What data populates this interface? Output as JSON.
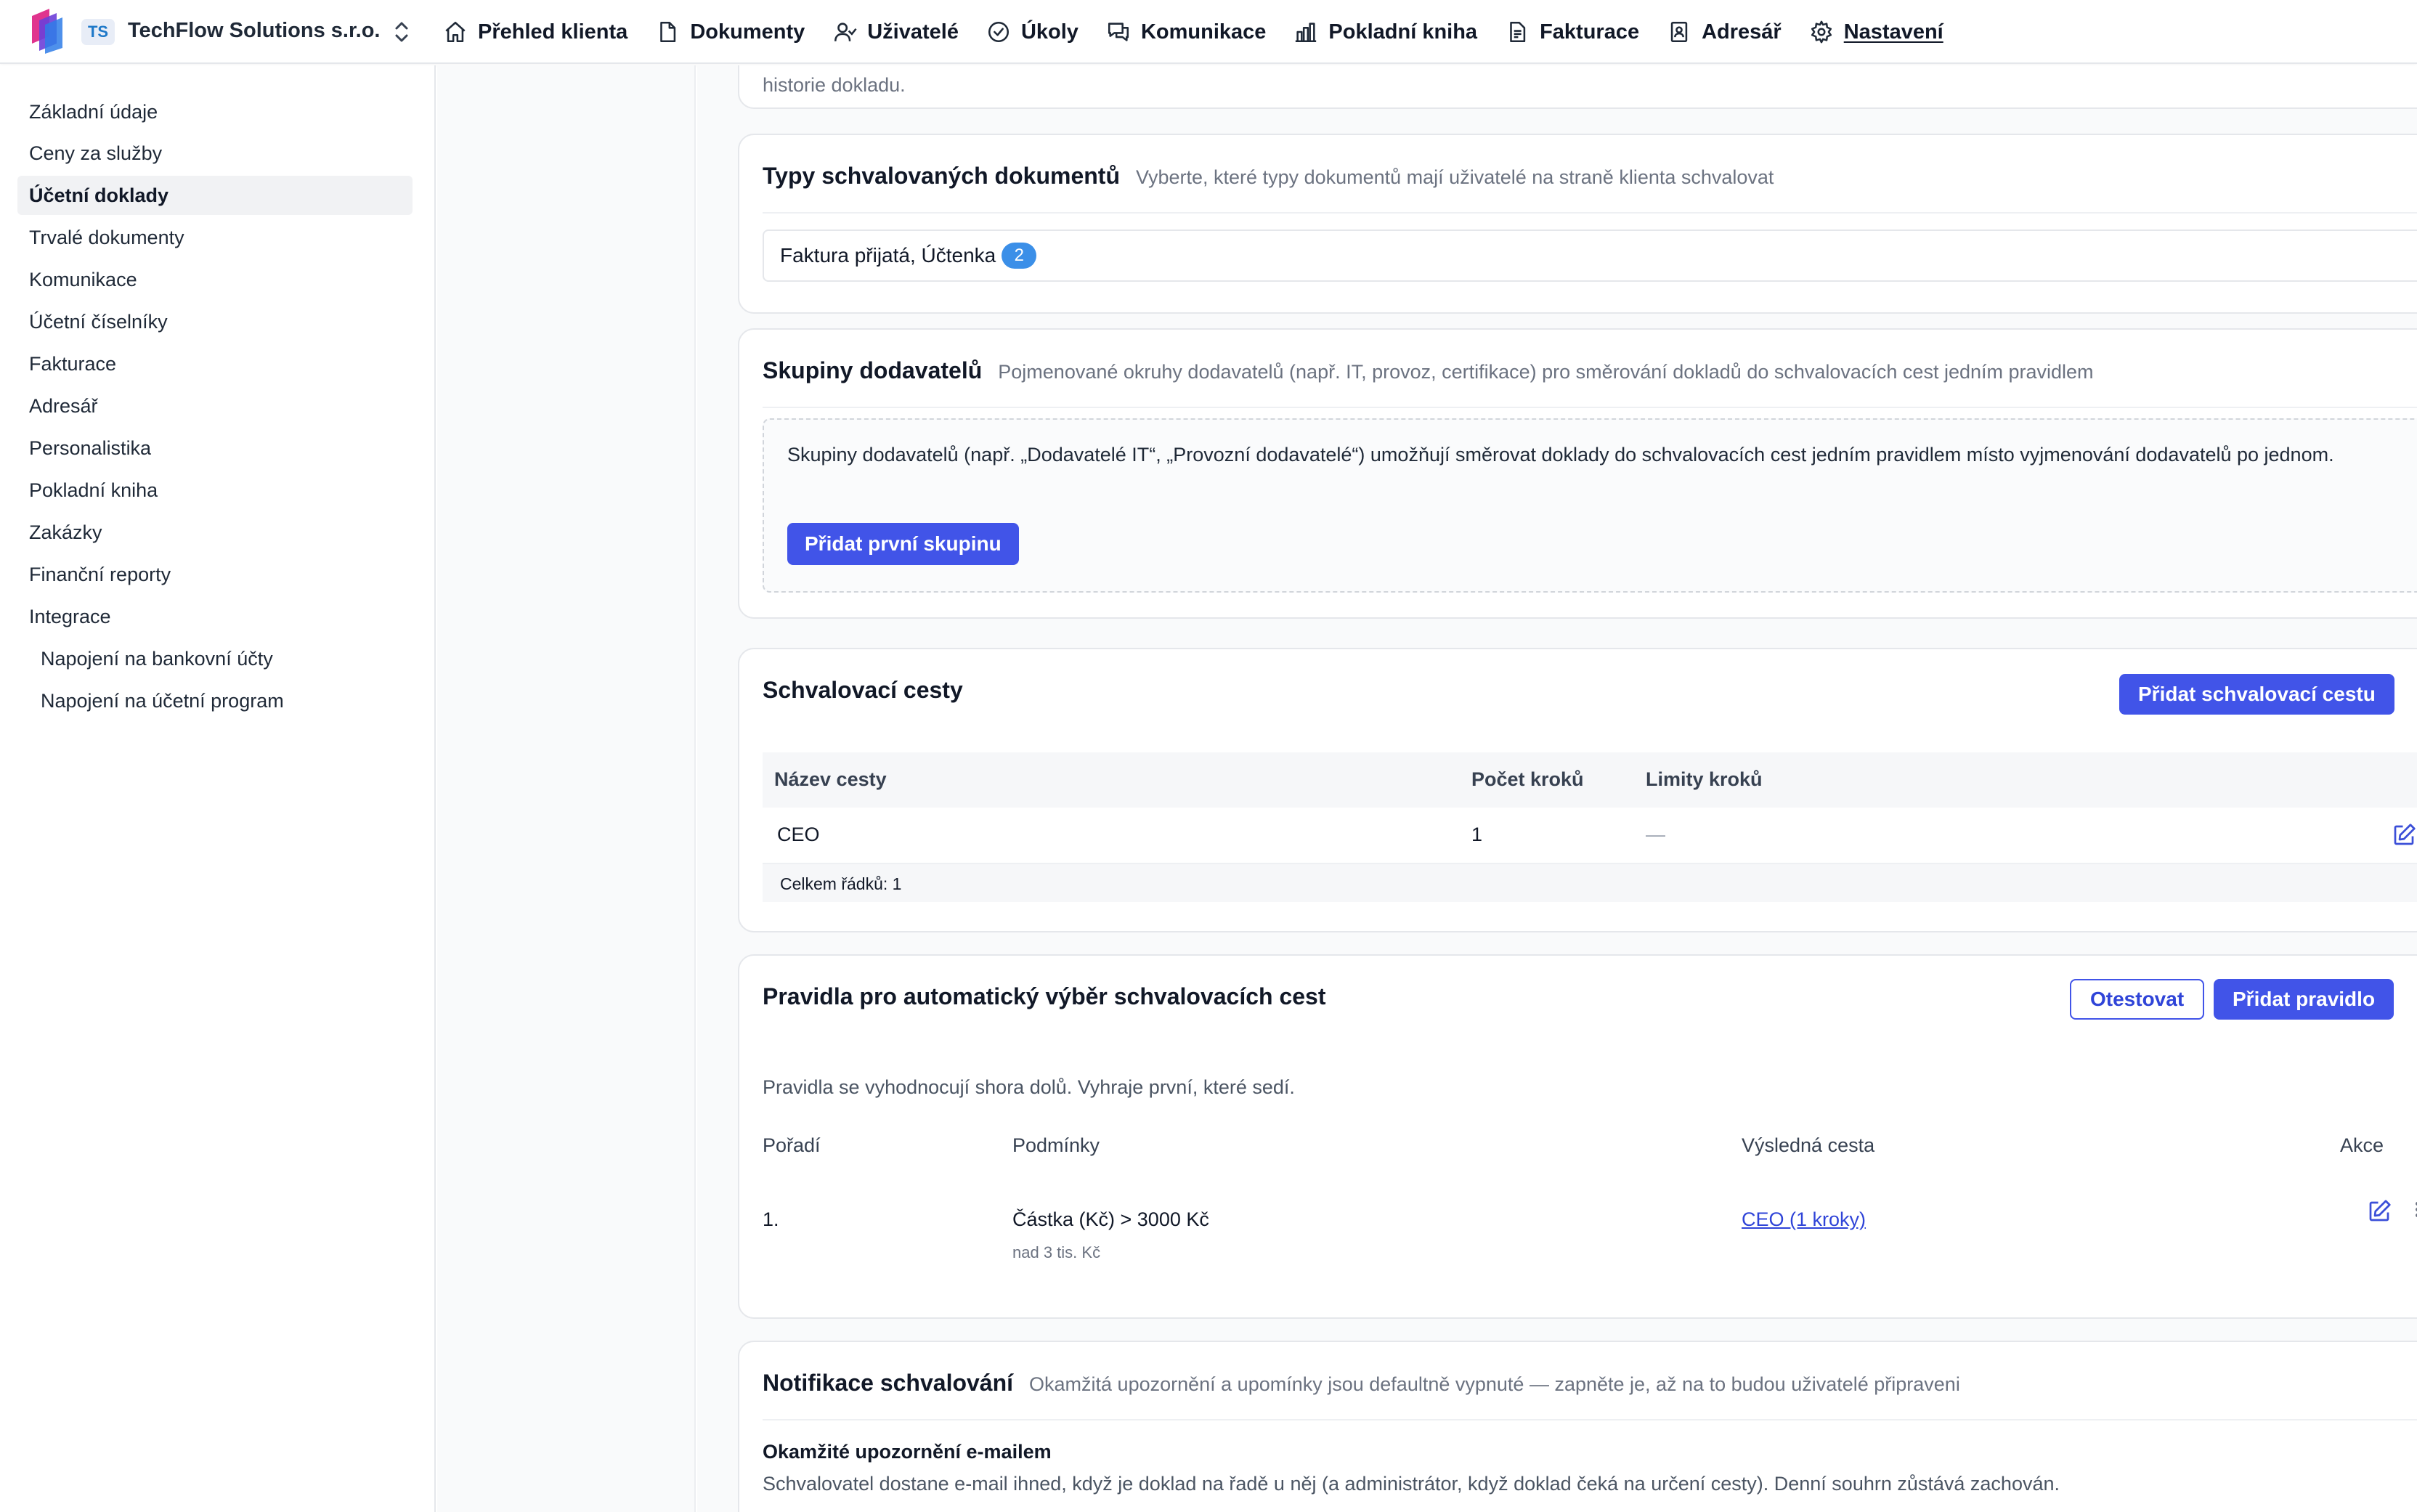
{
  "org": {
    "badge": "TS",
    "name": "TechFlow Solutions s.r.o."
  },
  "nav": [
    {
      "label": "Přehled klienta",
      "icon": "home-icon"
    },
    {
      "label": "Dokumenty",
      "icon": "document-icon"
    },
    {
      "label": "Uživatelé",
      "icon": "users-icon"
    },
    {
      "label": "Úkoly",
      "icon": "check-circle-icon"
    },
    {
      "label": "Komunikace",
      "icon": "chat-icon"
    },
    {
      "label": "Pokladní kniha",
      "icon": "cash-book-icon"
    },
    {
      "label": "Fakturace",
      "icon": "invoice-icon"
    },
    {
      "label": "Adresář",
      "icon": "contacts-icon"
    },
    {
      "label": "Nastavení",
      "icon": "gear-icon",
      "active": true
    }
  ],
  "sidebar": {
    "items": [
      {
        "label": "Základní údaje"
      },
      {
        "label": "Ceny za služby"
      },
      {
        "label": "Účetní doklady",
        "active": true
      },
      {
        "label": "Trvalé dokumenty"
      },
      {
        "label": "Komunikace"
      },
      {
        "label": "Účetní číselníky"
      },
      {
        "label": "Fakturace"
      },
      {
        "label": "Adresář"
      },
      {
        "label": "Personalistika"
      },
      {
        "label": "Pokladní kniha"
      },
      {
        "label": "Zakázky"
      },
      {
        "label": "Finanční reporty"
      },
      {
        "label": "Integrace"
      },
      {
        "label": "Napojení na bankovní účty",
        "sub": true
      },
      {
        "label": "Napojení na účetní program",
        "sub": true
      }
    ]
  },
  "prev_card": {
    "tail_text": "historie dokladu."
  },
  "doc_types": {
    "title": "Typy schvalovaných dokumentů",
    "desc": "Vyberte, které typy dokumentů mají uživatelé na straně klienta schvalovat",
    "selected_value": "Faktura přijatá, Účtenka",
    "count": "2"
  },
  "supplier_groups": {
    "title": "Skupiny dodavatelů",
    "desc": "Pojmenované okruhy dodavatelů (např. IT, provoz, certifikace) pro směrování dokladů do schvalovacích cest jedním pravidlem",
    "empty_text": "Skupiny dodavatelů (např. „Dodavatelé IT“, „Provozní dodavatelé“) umožňují směrovat doklady do schvalovacích cest jedním pravidlem místo vyjmenování dodavatelů po jednom.",
    "add_button": "Přidat první skupinu"
  },
  "approval_paths": {
    "title": "Schvalovací cesty",
    "add_button": "Přidat schvalovací cestu",
    "columns": [
      "Název cesty",
      "Počet kroků",
      "Limity kroků"
    ],
    "rows": [
      {
        "name": "CEO",
        "steps": "1",
        "limits": "—"
      }
    ],
    "footer": "Celkem řádků: 1"
  },
  "rules": {
    "title": "Pravidla pro automatický výběr schvalovacích cest",
    "test_button": "Otestovat",
    "add_button": "Přidat pravidlo",
    "note": "Pravidla se vyhodnocují shora dolů. Vyhraje první, které sedí.",
    "columns": [
      "Pořadí",
      "Podmínky",
      "Výsledná cesta",
      "Akce"
    ],
    "rows": [
      {
        "order": "1.",
        "condition": "Částka (Kč) > 3000 Kč",
        "condition_hint": "nad 3 tis. Kč",
        "path": "CEO (1 kroky)"
      }
    ]
  },
  "notifications": {
    "title": "Notifikace schvalování",
    "desc": "Okamžitá upozornění a upomínky jsou defaultně vypnuté — zapněte je, až na to budou uživatelé připraveni",
    "email_title": "Okamžité upozornění e-mailem",
    "email_desc": "Schvalovatel dostane e-mail ihned, když je doklad na řadě u něj (a administrátor, když doklad čeká na určení cesty). Denní souhrn zůstává zachován.",
    "email_enabled": false
  },
  "colors": {
    "primary": "#4154e8",
    "badge": "#3b8fe8",
    "link": "#2f44d8"
  }
}
